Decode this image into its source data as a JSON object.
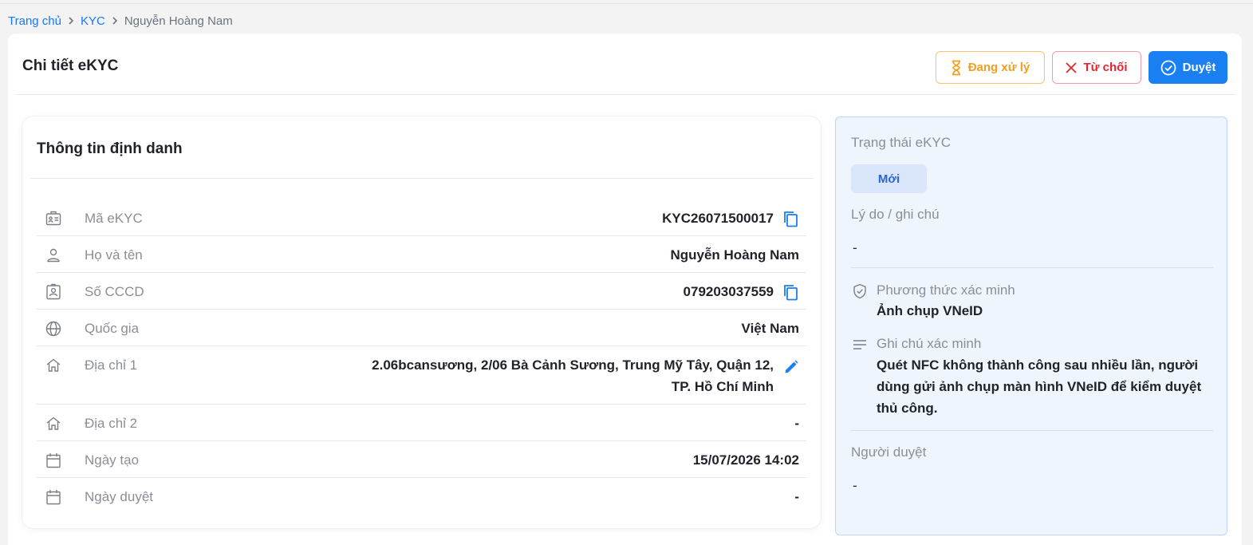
{
  "breadcrumb": {
    "home": "Trang chủ",
    "section": "KYC",
    "current": "Nguyễn Hoàng Nam"
  },
  "header": {
    "title": "Chi tiết eKYC",
    "buttons": {
      "processing": "Đang xử lý",
      "reject": "Từ chối",
      "approve": "Duyệt"
    }
  },
  "identity": {
    "title": "Thông tin định danh",
    "rows": [
      {
        "label": "Mã eKYC",
        "value": "KYC26071500017",
        "icon": "id-card-icon",
        "action": "copy-icon"
      },
      {
        "label": "Họ và tên",
        "value": "Nguyễn Hoàng Nam",
        "icon": "user-icon"
      },
      {
        "label": "Số CCCD",
        "value": "079203037559",
        "icon": "id-badge-icon",
        "action": "copy-icon"
      },
      {
        "label": "Quốc gia",
        "value": "Việt Nam",
        "icon": "globe-icon"
      },
      {
        "label": "Địa chỉ 1",
        "value_line1": "2.06bcansương, 2/06 Bà Cảnh Sương, Trung Mỹ Tây, Quận 12,",
        "value_line2": "TP. Hồ Chí Minh",
        "icon": "home-icon",
        "action": "edit-icon"
      },
      {
        "label": "Địa chỉ 2",
        "value": "-",
        "icon": "home-icon"
      },
      {
        "label": "Ngày tạo",
        "value": "15/07/2026 14:02",
        "icon": "calendar-icon"
      },
      {
        "label": "Ngày duyệt",
        "value": "-",
        "icon": "calendar-icon"
      }
    ]
  },
  "status_panel": {
    "status_label": "Trạng thái eKYC",
    "status_badge": "Mới",
    "reason_label": "Lý do / ghi chú",
    "reason_value": "-",
    "method_label": "Phương thức xác minh",
    "method_value": "Ảnh chụp VNeID",
    "method_icon": "shield-check-icon",
    "note_label": "Ghi chú xác minh",
    "note_value": "Quét NFC không thành công sau nhiều lần, người dùng gửi ảnh chụp màn hình VNeID để kiểm duyệt thủ công.",
    "note_icon": "lines-icon",
    "reviewer_label": "Người duyệt",
    "reviewer_value": "-"
  },
  "colors": {
    "accent": "#1a7ff0",
    "warning": "#f0a020",
    "danger": "#e5242f",
    "status_badge_bg": "#d9e6fb"
  }
}
